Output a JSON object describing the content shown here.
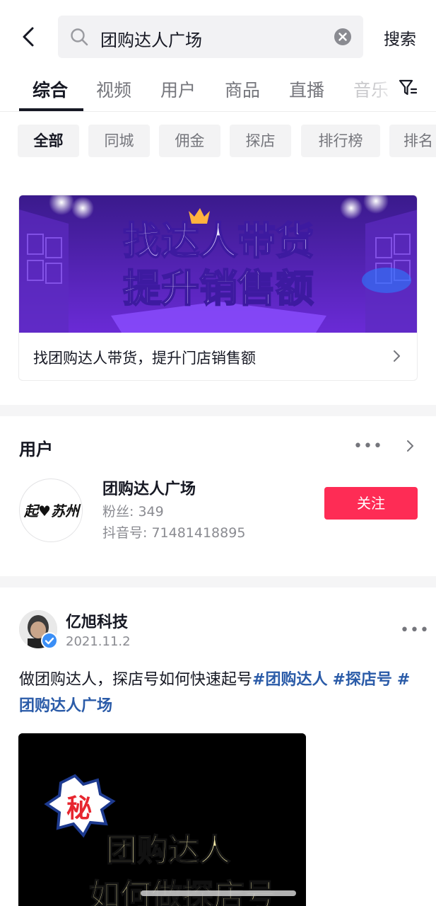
{
  "search": {
    "query": "团购达人广场",
    "submit_label": "搜索"
  },
  "tabs": [
    {
      "label": "综合",
      "active": true
    },
    {
      "label": "视频"
    },
    {
      "label": "用户"
    },
    {
      "label": "商品"
    },
    {
      "label": "直播"
    },
    {
      "label": "音乐"
    }
  ],
  "chips": [
    {
      "label": "全部",
      "active": true
    },
    {
      "label": "同城"
    },
    {
      "label": "佣金"
    },
    {
      "label": "探店"
    },
    {
      "label": "排行榜"
    },
    {
      "label": "排名"
    }
  ],
  "banner": {
    "line1": "找达人带货",
    "line2": "提升销售额",
    "caption": "找团购达人带货，提升门店销售额"
  },
  "users_section": {
    "title": "用户",
    "user": {
      "name": "团购达人广场",
      "avatar_text": "起♥苏州",
      "followers": "粉丝: 349",
      "douyin_id": "抖音号: 71481418895",
      "follow_label": "关注"
    }
  },
  "post": {
    "author": "亿旭科技",
    "date": "2021.11.2",
    "text": "做团购达人，探店号如何快速起号",
    "hashtags": [
      "#团购达人",
      "#探店号",
      "#团购达人广场"
    ],
    "thumb_badge": "秘",
    "thumb_line1": "团购达人",
    "thumb_line2": "如何做探店号"
  },
  "colors": {
    "accent": "#fe2c55",
    "hashtag": "#2a5ba8",
    "text": "#161823",
    "muted": "#8a8b91"
  }
}
